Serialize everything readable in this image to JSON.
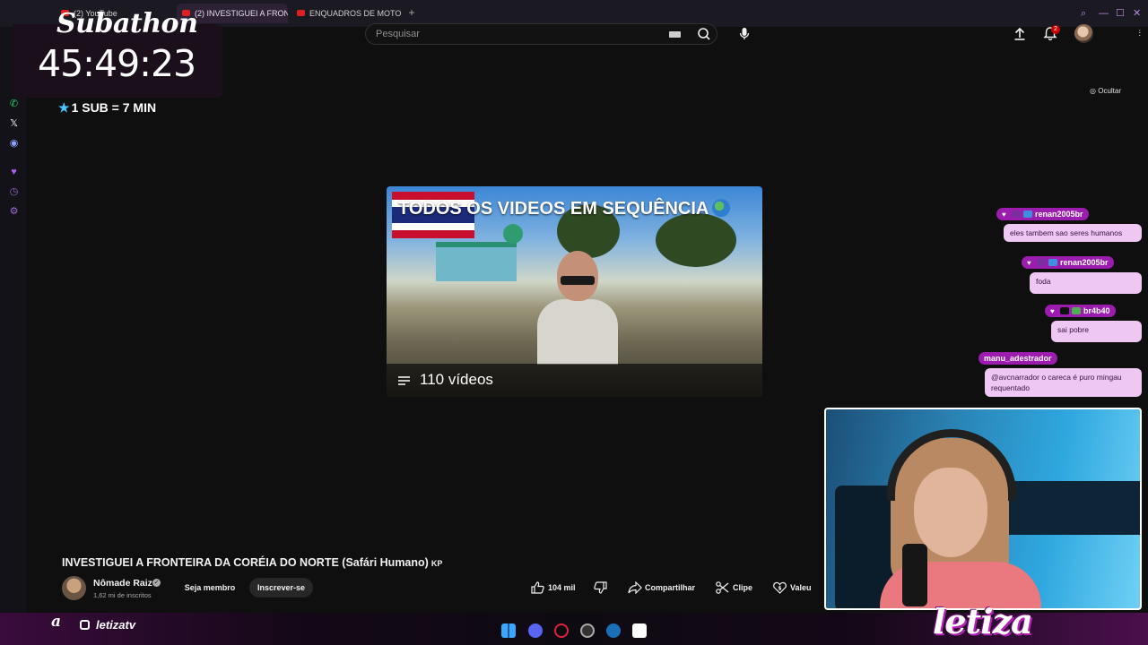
{
  "browser": {
    "tabs": [
      {
        "label": "(2) YouTube",
        "active": false
      },
      {
        "label": "(2) INVESTIGUEI A FRON",
        "active": true
      },
      {
        "label": "ENQUADROS DE MOTO (",
        "active": false
      }
    ]
  },
  "header": {
    "search_placeholder": "Pesquisar",
    "notification_count": "2"
  },
  "overlay": {
    "subathon_title": "Subathon",
    "subathon_timer": "45:49:23",
    "sub_rule": "1 SUB = 7 MIN",
    "hide_label": "Ocultar"
  },
  "playlist": {
    "title": "TODOS OS VIDEOS EM SEQUÊNCIA",
    "count": "110 vídeos"
  },
  "video": {
    "title": "INVESTIGUEI A FRONTEIRA DA CORÉIA DO NORTE (Safári Humano)",
    "title_suffix": "KP",
    "channel_name": "Nômade Raiz",
    "channel_subs": "1,62 mi de inscritos",
    "join_label": "Seja membro",
    "subscribe_label": "Inscrever-se",
    "likes": "104 mil",
    "share_label": "Compartilhar",
    "clip_label": "Clipe",
    "thanks_label": "Valeu"
  },
  "chat": [
    {
      "user": "renan2005br",
      "message": "eles tambem sao seres humanos"
    },
    {
      "user": "renan2005br",
      "message": "foda"
    },
    {
      "user": "br4b40",
      "message": "sai pobre"
    },
    {
      "user": "manu_adestrador",
      "message": "@avcnarrador o careca é puro mingau requentado"
    }
  ],
  "stream": {
    "instagram_handle": "letizatv",
    "logo_text": "letiza"
  },
  "colors": {
    "chat_name_bg": "#9c1cb0",
    "chat_msg_bg": "#eec8f3",
    "accent": "#b98ae0"
  }
}
